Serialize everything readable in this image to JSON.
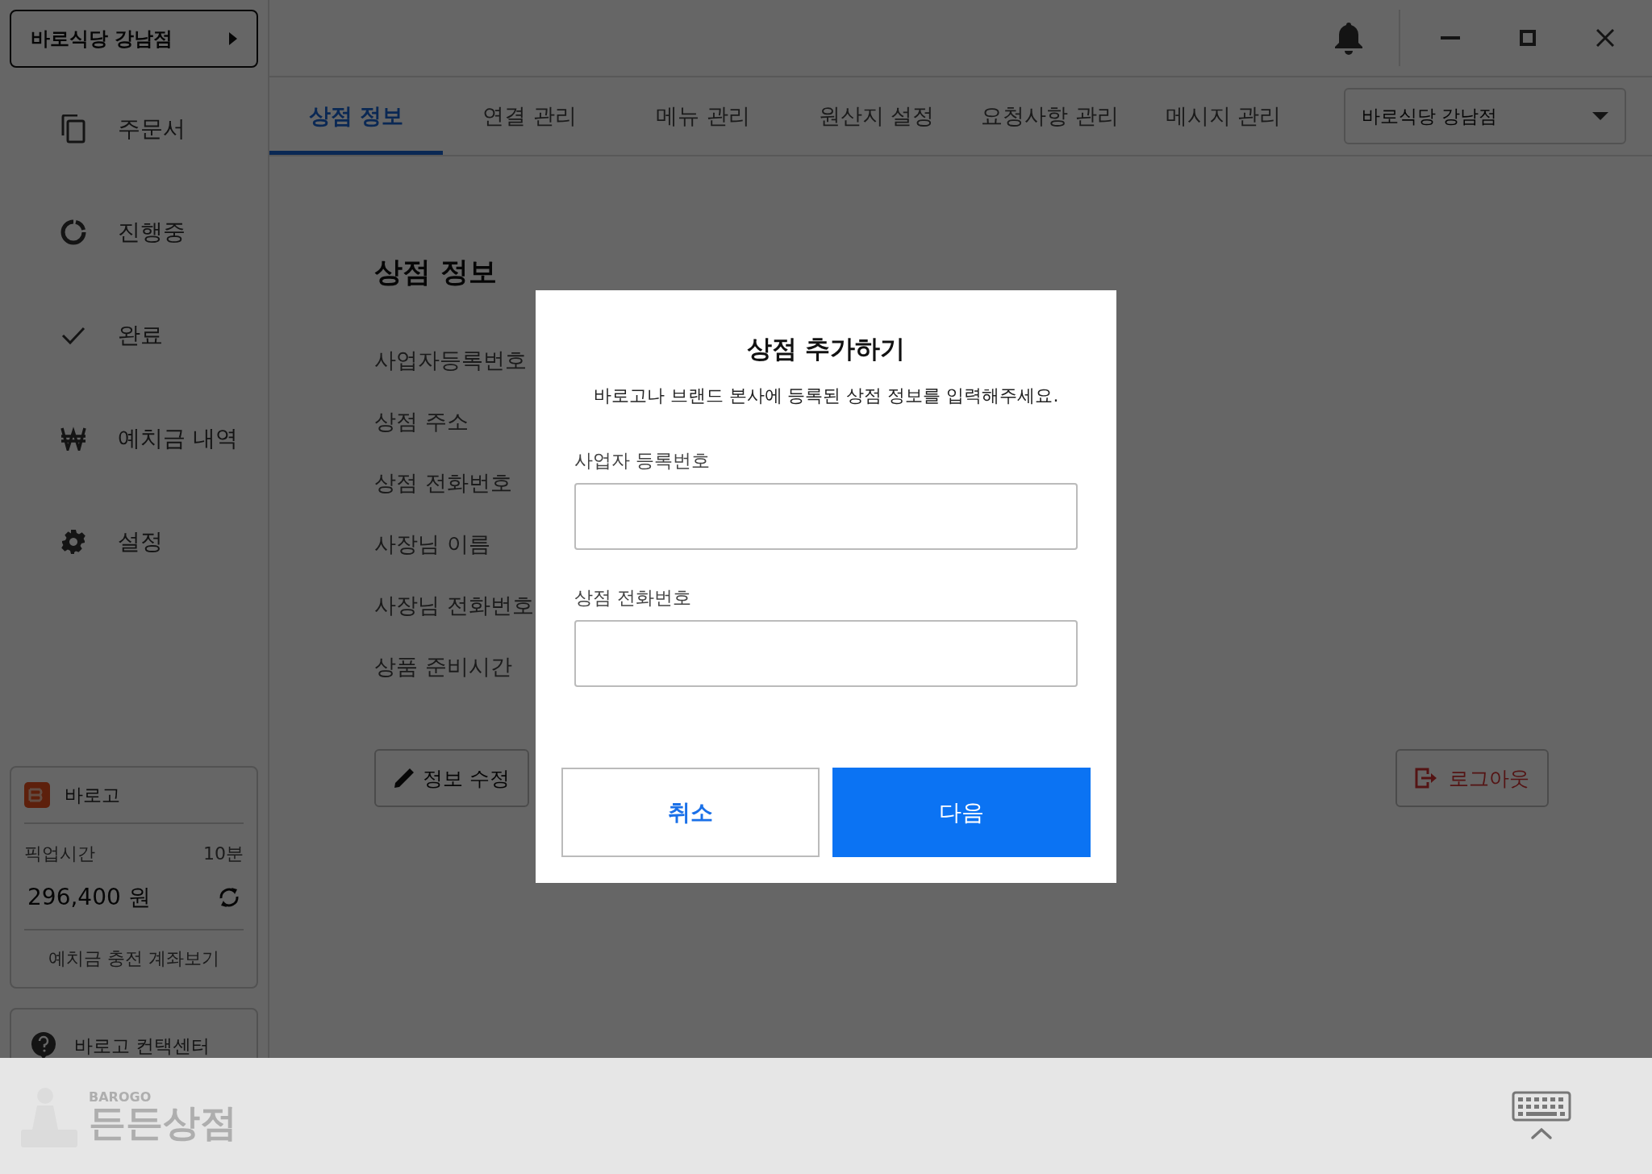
{
  "store_button": {
    "label": "바로식당 강남점"
  },
  "sidebar": {
    "items": [
      {
        "label": "주문서"
      },
      {
        "label": "진행중"
      },
      {
        "label": "완료"
      },
      {
        "label": "예치금 내역"
      },
      {
        "label": "설정"
      }
    ]
  },
  "balance_card": {
    "brand": "바로고",
    "pickup_label": "픽업시간",
    "pickup_value": "10분",
    "balance": "296,400 원",
    "link": "예치금 충전 계좌보기"
  },
  "contact": {
    "label": "바로고 컨택센터"
  },
  "tabs": [
    {
      "label": "상점 정보",
      "selected": true
    },
    {
      "label": "연결 관리",
      "selected": false
    },
    {
      "label": "메뉴 관리",
      "selected": false
    },
    {
      "label": "원산지 설정",
      "selected": false
    },
    {
      "label": "요청사항 관리",
      "selected": false
    },
    {
      "label": "메시지 관리",
      "selected": false
    }
  ],
  "store_select": {
    "value": "바로식당 강남점"
  },
  "store_info": {
    "heading": "상점 정보",
    "fields": [
      "사업자등록번호",
      "상점 주소",
      "상점 전화번호",
      "사장님 이름",
      "사장님 전화번호",
      "상품 준비시간"
    ],
    "edit_button": "정보 수정",
    "logout_button": "로그아웃"
  },
  "dialog": {
    "title": "상점 추가하기",
    "description": "바로고나 브랜드 본사에 등록된 상점 정보를 입력해주세요.",
    "fields": [
      {
        "label": "사업자 등록번호"
      },
      {
        "label": "상점 전화번호"
      }
    ],
    "buttons": [
      {
        "label": "취소",
        "kind": "secondary"
      },
      {
        "label": "다음",
        "kind": "primary"
      }
    ]
  },
  "bottom_bar": {
    "logo_small": "BAROGO",
    "logo_large": "든든상점"
  }
}
